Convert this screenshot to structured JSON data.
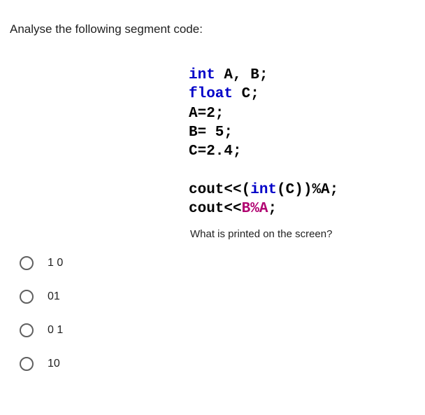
{
  "question": {
    "title": "Analyse the following segment code:",
    "sub_prompt": "What is printed on the screen?"
  },
  "code": {
    "l1_kw": "int",
    "l1_rest": " A, B;",
    "l2_kw": "float",
    "l2_rest": " C;",
    "l3": "A=2;",
    "l4": "B= 5;",
    "l5": "C=2.4;",
    "l6_a": "cout<<(",
    "l6_kw": "int",
    "l6_b": "(C))%A;",
    "l7_a": "cout<<",
    "l7_b": "B%A",
    "l7_c": ";"
  },
  "options": {
    "o1": "1 0",
    "o2": "01",
    "o3": "0 1",
    "o4": "10"
  }
}
